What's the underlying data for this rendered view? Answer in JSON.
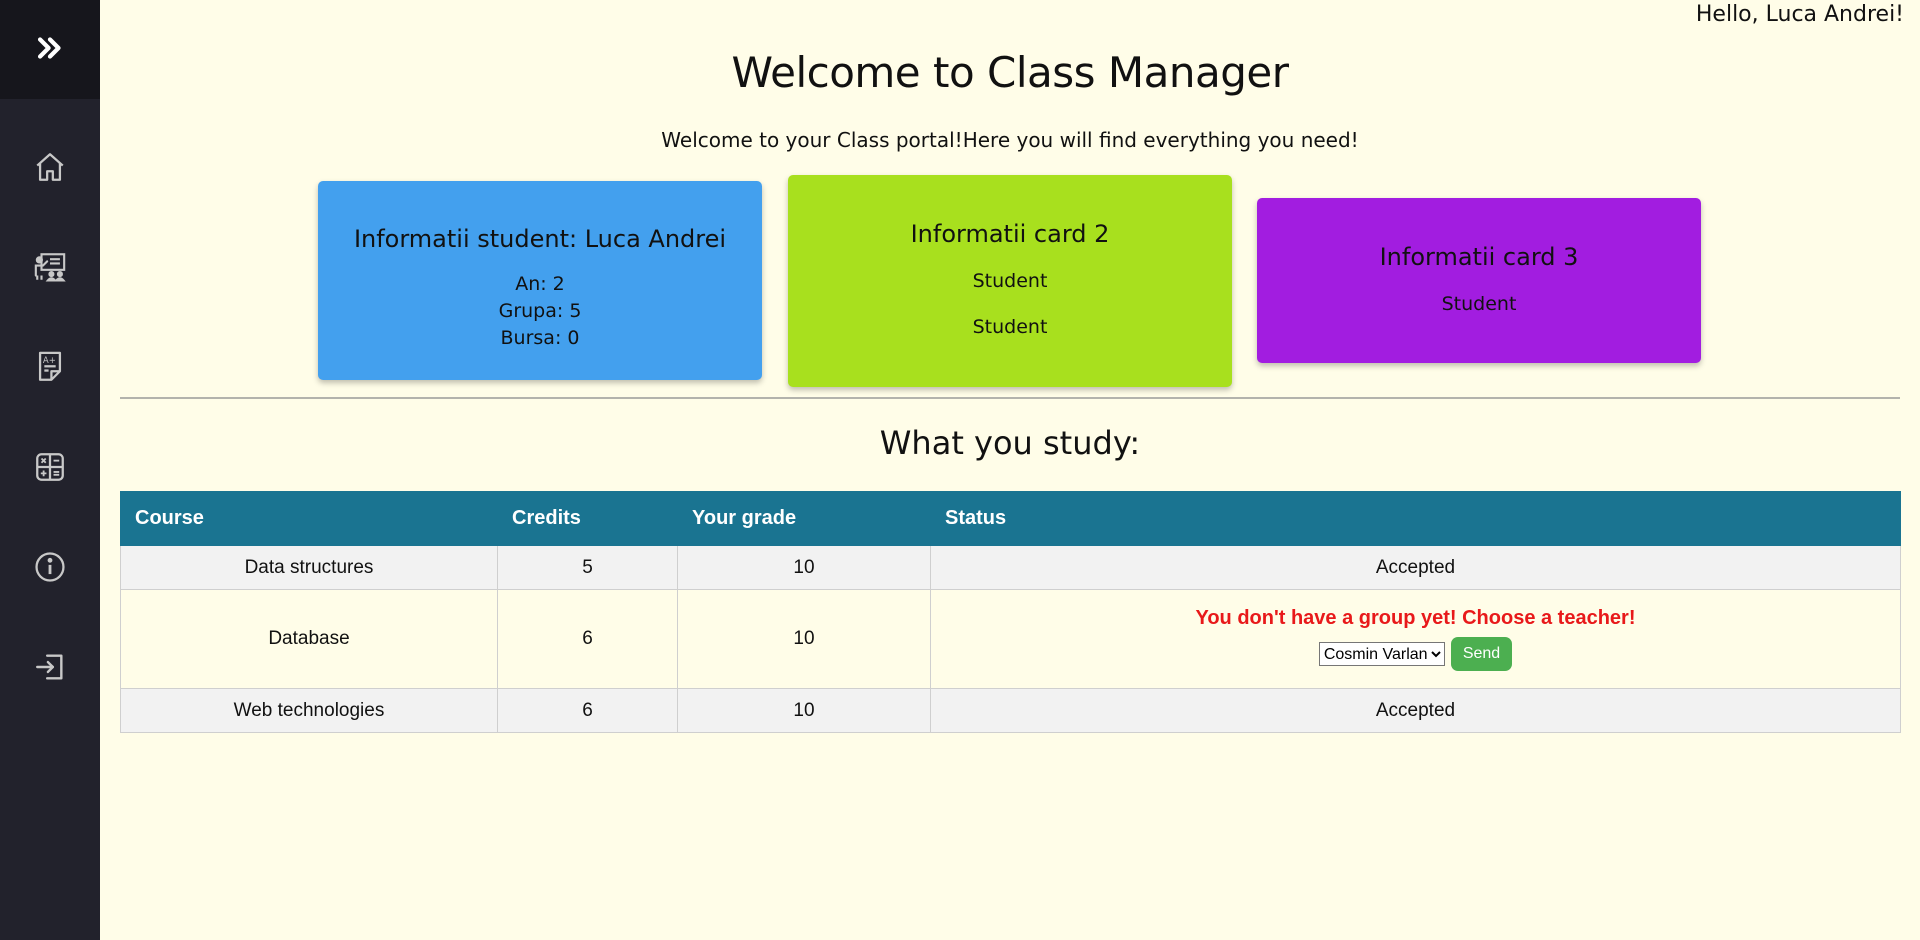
{
  "sidebar": {
    "toggle_icon": "double-chevron-right-icon",
    "items": [
      {
        "name": "home",
        "icon": "home-icon"
      },
      {
        "name": "classroom",
        "icon": "teacher-classroom-icon"
      },
      {
        "name": "grades",
        "icon": "grade-sheet-icon"
      },
      {
        "name": "calculator",
        "icon": "calculator-icon"
      },
      {
        "name": "info",
        "icon": "info-icon"
      },
      {
        "name": "logout",
        "icon": "logout-icon"
      }
    ]
  },
  "header": {
    "greeting": "Hello, Luca Andrei!",
    "title": "Welcome to Class Manager",
    "subtitle": "Welcome to your Class portal!Here you will find everything you need!"
  },
  "cards": [
    {
      "title": "Informatii student: Luca Andrei",
      "lines": [
        "An: 2",
        "Grupa: 5",
        "Bursa: 0"
      ],
      "color": "#43a0ee"
    },
    {
      "title": "Informatii card 2",
      "lines": [
        "Student",
        "Student"
      ],
      "color": "#a8e01e"
    },
    {
      "title": "Informatii card 3",
      "lines": [
        "Student"
      ],
      "color": "#a21de0"
    }
  ],
  "study": {
    "title": "What you study:",
    "columns": [
      "Course",
      "Credits",
      "Your grade",
      "Status"
    ],
    "rows": [
      {
        "course": "Data structures",
        "credits": "5",
        "grade": "10",
        "status": "Accepted"
      },
      {
        "course": "Database",
        "credits": "6",
        "grade": "10",
        "status_warning": "You don't have a group yet! Choose a teacher!",
        "teacher_selected": "Cosmin Varlan",
        "send_label": "Send"
      },
      {
        "course": "Web technologies",
        "credits": "6",
        "grade": "10",
        "status": "Accepted"
      }
    ]
  },
  "colors": {
    "sidebar_bg": "#22222c",
    "page_bg": "#fffde8",
    "table_header": "#1a7491",
    "warning": "#e8191a",
    "send_button": "#4caf50"
  }
}
